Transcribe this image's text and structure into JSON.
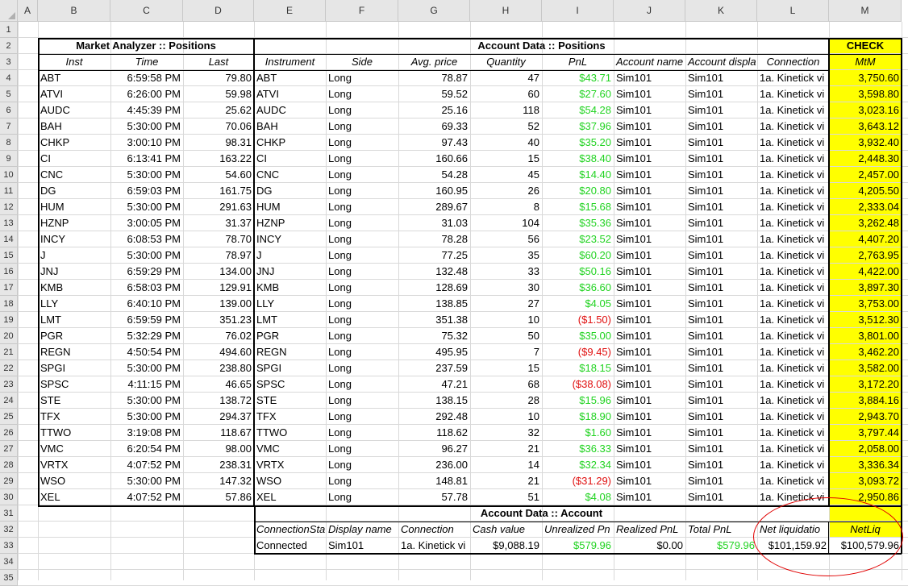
{
  "columns": [
    "A",
    "B",
    "C",
    "D",
    "E",
    "F",
    "G",
    "H",
    "I",
    "J",
    "K",
    "L",
    "M"
  ],
  "rows": [
    "1",
    "2",
    "3",
    "4",
    "5",
    "6",
    "7",
    "8",
    "9",
    "10",
    "11",
    "12",
    "13",
    "14",
    "15",
    "16",
    "17",
    "18",
    "19",
    "20",
    "21",
    "22",
    "23",
    "24",
    "25",
    "26",
    "27",
    "28",
    "29",
    "30",
    "31",
    "32",
    "33",
    "34",
    "35"
  ],
  "market": {
    "title": "Market Analyzer :: Positions",
    "headers": [
      "Inst",
      "Time",
      "Last"
    ],
    "rows": [
      [
        "ABT",
        "6:59:58 PM",
        "79.80"
      ],
      [
        "ATVI",
        "6:26:00 PM",
        "59.98"
      ],
      [
        "AUDC",
        "4:45:39 PM",
        "25.62"
      ],
      [
        "BAH",
        "5:30:00 PM",
        "70.06"
      ],
      [
        "CHKP",
        "3:00:10 PM",
        "98.31"
      ],
      [
        "CI",
        "6:13:41 PM",
        "163.22"
      ],
      [
        "CNC",
        "5:30:00 PM",
        "54.60"
      ],
      [
        "DG",
        "6:59:03 PM",
        "161.75"
      ],
      [
        "HUM",
        "5:30:00 PM",
        "291.63"
      ],
      [
        "HZNP",
        "3:00:05 PM",
        "31.37"
      ],
      [
        "INCY",
        "6:08:53 PM",
        "78.70"
      ],
      [
        "J",
        "5:30:00 PM",
        "78.97"
      ],
      [
        "JNJ",
        "6:59:29 PM",
        "134.00"
      ],
      [
        "KMB",
        "6:58:03 PM",
        "129.91"
      ],
      [
        "LLY",
        "6:40:10 PM",
        "139.00"
      ],
      [
        "LMT",
        "6:59:59 PM",
        "351.23"
      ],
      [
        "PGR",
        "5:32:29 PM",
        "76.02"
      ],
      [
        "REGN",
        "4:50:54 PM",
        "494.60"
      ],
      [
        "SPGI",
        "5:30:00 PM",
        "238.80"
      ],
      [
        "SPSC",
        "4:11:15 PM",
        "46.65"
      ],
      [
        "STE",
        "5:30:00 PM",
        "138.72"
      ],
      [
        "TFX",
        "5:30:00 PM",
        "294.37"
      ],
      [
        "TTWO",
        "3:19:08 PM",
        "118.67"
      ],
      [
        "VMC",
        "6:20:54 PM",
        "98.00"
      ],
      [
        "VRTX",
        "4:07:52 PM",
        "238.31"
      ],
      [
        "WSO",
        "5:30:00 PM",
        "147.32"
      ],
      [
        "XEL",
        "4:07:52 PM",
        "57.86"
      ]
    ]
  },
  "account_positions": {
    "title": "Account Data :: Positions",
    "headers": [
      "Instrument",
      "Side",
      "Avg. price",
      "Quantity",
      "PnL",
      "Account name",
      "Account displa",
      "Connection"
    ],
    "rows": [
      [
        "ABT",
        "Long",
        "78.87",
        "47",
        "$43.71",
        "Sim101",
        "Sim101",
        "1a. Kinetick vi"
      ],
      [
        "ATVI",
        "Long",
        "59.52",
        "60",
        "$27.60",
        "Sim101",
        "Sim101",
        "1a. Kinetick vi"
      ],
      [
        "AUDC",
        "Long",
        "25.16",
        "118",
        "$54.28",
        "Sim101",
        "Sim101",
        "1a. Kinetick vi"
      ],
      [
        "BAH",
        "Long",
        "69.33",
        "52",
        "$37.96",
        "Sim101",
        "Sim101",
        "1a. Kinetick vi"
      ],
      [
        "CHKP",
        "Long",
        "97.43",
        "40",
        "$35.20",
        "Sim101",
        "Sim101",
        "1a. Kinetick vi"
      ],
      [
        "CI",
        "Long",
        "160.66",
        "15",
        "$38.40",
        "Sim101",
        "Sim101",
        "1a. Kinetick vi"
      ],
      [
        "CNC",
        "Long",
        "54.28",
        "45",
        "$14.40",
        "Sim101",
        "Sim101",
        "1a. Kinetick vi"
      ],
      [
        "DG",
        "Long",
        "160.95",
        "26",
        "$20.80",
        "Sim101",
        "Sim101",
        "1a. Kinetick vi"
      ],
      [
        "HUM",
        "Long",
        "289.67",
        "8",
        "$15.68",
        "Sim101",
        "Sim101",
        "1a. Kinetick vi"
      ],
      [
        "HZNP",
        "Long",
        "31.03",
        "104",
        "$35.36",
        "Sim101",
        "Sim101",
        "1a. Kinetick vi"
      ],
      [
        "INCY",
        "Long",
        "78.28",
        "56",
        "$23.52",
        "Sim101",
        "Sim101",
        "1a. Kinetick vi"
      ],
      [
        "J",
        "Long",
        "77.25",
        "35",
        "$60.20",
        "Sim101",
        "Sim101",
        "1a. Kinetick vi"
      ],
      [
        "JNJ",
        "Long",
        "132.48",
        "33",
        "$50.16",
        "Sim101",
        "Sim101",
        "1a. Kinetick vi"
      ],
      [
        "KMB",
        "Long",
        "128.69",
        "30",
        "$36.60",
        "Sim101",
        "Sim101",
        "1a. Kinetick vi"
      ],
      [
        "LLY",
        "Long",
        "138.85",
        "27",
        "$4.05",
        "Sim101",
        "Sim101",
        "1a. Kinetick vi"
      ],
      [
        "LMT",
        "Long",
        "351.38",
        "10",
        "($1.50)",
        "Sim101",
        "Sim101",
        "1a. Kinetick vi"
      ],
      [
        "PGR",
        "Long",
        "75.32",
        "50",
        "$35.00",
        "Sim101",
        "Sim101",
        "1a. Kinetick vi"
      ],
      [
        "REGN",
        "Long",
        "495.95",
        "7",
        "($9.45)",
        "Sim101",
        "Sim101",
        "1a. Kinetick vi"
      ],
      [
        "SPGI",
        "Long",
        "237.59",
        "15",
        "$18.15",
        "Sim101",
        "Sim101",
        "1a. Kinetick vi"
      ],
      [
        "SPSC",
        "Long",
        "47.21",
        "68",
        "($38.08)",
        "Sim101",
        "Sim101",
        "1a. Kinetick vi"
      ],
      [
        "STE",
        "Long",
        "138.15",
        "28",
        "$15.96",
        "Sim101",
        "Sim101",
        "1a. Kinetick vi"
      ],
      [
        "TFX",
        "Long",
        "292.48",
        "10",
        "$18.90",
        "Sim101",
        "Sim101",
        "1a. Kinetick vi"
      ],
      [
        "TTWO",
        "Long",
        "118.62",
        "32",
        "$1.60",
        "Sim101",
        "Sim101",
        "1a. Kinetick vi"
      ],
      [
        "VMC",
        "Long",
        "96.27",
        "21",
        "$36.33",
        "Sim101",
        "Sim101",
        "1a. Kinetick vi"
      ],
      [
        "VRTX",
        "Long",
        "236.00",
        "14",
        "$32.34",
        "Sim101",
        "Sim101",
        "1a. Kinetick vi"
      ],
      [
        "WSO",
        "Long",
        "148.81",
        "21",
        "($31.29)",
        "Sim101",
        "Sim101",
        "1a. Kinetick vi"
      ],
      [
        "XEL",
        "Long",
        "57.78",
        "51",
        "$4.08",
        "Sim101",
        "Sim101",
        "1a. Kinetick vi"
      ]
    ]
  },
  "check": {
    "title": "CHECK",
    "header": "MtM",
    "values": [
      "3,750.60",
      "3,598.80",
      "3,023.16",
      "3,643.12",
      "3,932.40",
      "2,448.30",
      "2,457.00",
      "4,205.50",
      "2,333.04",
      "3,262.48",
      "4,407.20",
      "2,763.95",
      "4,422.00",
      "3,897.30",
      "3,753.00",
      "3,512.30",
      "3,801.00",
      "3,462.20",
      "3,582.00",
      "3,172.20",
      "3,884.16",
      "2,943.70",
      "3,797.44",
      "2,058.00",
      "3,336.34",
      "3,093.72",
      "2,950.86"
    ],
    "netliq_header": "NetLiq",
    "netliq_value": "$100,579.96"
  },
  "account": {
    "title": "Account Data :: Account",
    "headers": [
      "ConnectionSta",
      "Display name",
      "Connection",
      "Cash value",
      "Unrealized Pn",
      "Realized PnL",
      "Total PnL",
      "Net liquidatio"
    ],
    "values": [
      "Connected",
      "Sim101",
      "1a. Kinetick vi",
      "$9,088.19",
      "$579.96",
      "$0.00",
      "$579.96",
      "$101,159.92"
    ]
  },
  "colors": {
    "positive": "#21d321",
    "negative": "#e01010",
    "highlight": "#ffff00",
    "annotation": "#e00000"
  }
}
